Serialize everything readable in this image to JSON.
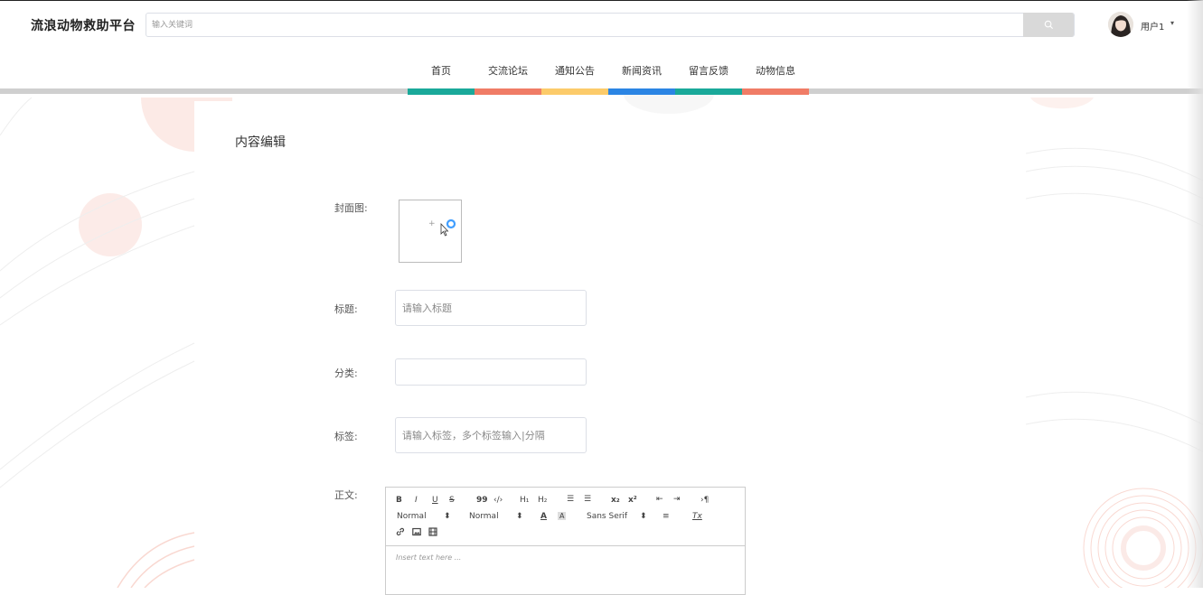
{
  "header": {
    "brand": "流浪动物救助平台",
    "search_placeholder": "输入关键词",
    "user_name": "用户1",
    "user_caret": "▾"
  },
  "nav": {
    "items": [
      "首页",
      "交流论坛",
      "通知公告",
      "新闻资讯",
      "留言反馈",
      "动物信息"
    ],
    "colors": [
      "#1aa99a",
      "#f07c66",
      "#fccb6a",
      "#2b85e4",
      "#1aa99a",
      "#f07c66"
    ]
  },
  "page": {
    "title": "内容编辑"
  },
  "form": {
    "cover_label": "封面图:",
    "cover_plus": "+",
    "title_label": "标题:",
    "title_placeholder": "请输入标题",
    "category_label": "分类:",
    "category_value": "",
    "tags_label": "标签:",
    "tags_placeholder": "请输入标签，多个标签输入|分隔",
    "body_label": "正文:"
  },
  "editor": {
    "toolbar_row1": {
      "bold": "B",
      "italic": "I",
      "underline": "U",
      "strike": "S",
      "blockquote": "99",
      "code": "‹/›",
      "h1": "H₁",
      "h2": "H₂",
      "ordered_list": "☰",
      "bullet_list": "☰",
      "subscript": "x₂",
      "superscript": "x²",
      "indent_left": "⇤",
      "indent_right": "⇥",
      "direction": "›¶"
    },
    "toolbar_row2": {
      "size_select": "Normal",
      "header_select": "Normal",
      "font_select": "Sans Serif",
      "color": "A",
      "background": "A",
      "align": "≡",
      "clean": "Tx"
    },
    "placeholder": "Insert text here ..."
  },
  "colors": {
    "accent_blue": "#409eff",
    "deco_pink": "#f6b3a8"
  }
}
